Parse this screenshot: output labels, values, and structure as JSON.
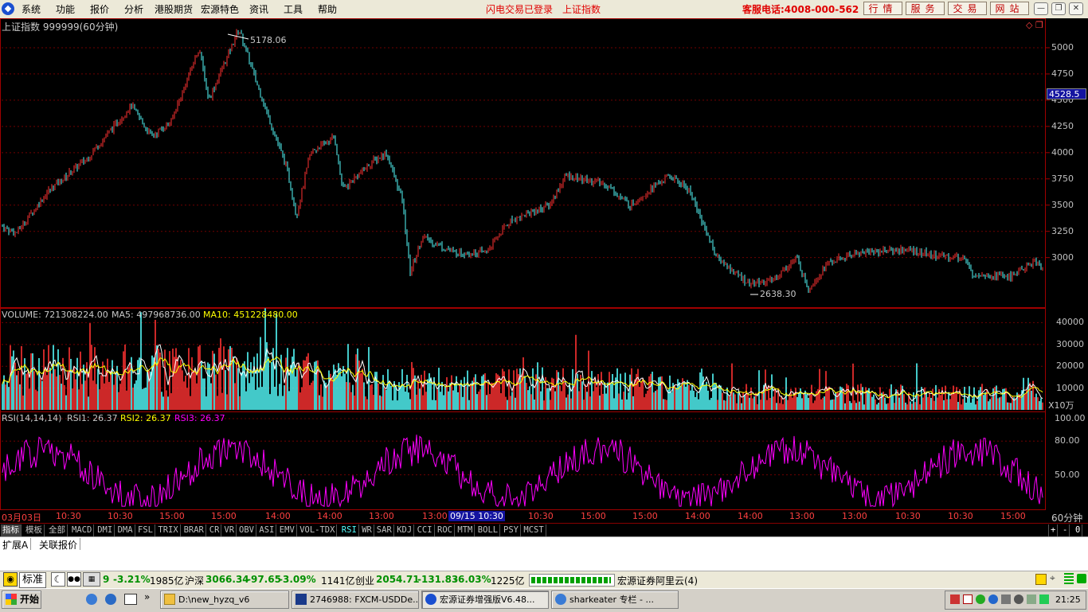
{
  "menubar": {
    "items": [
      "系统",
      "功能",
      "报价",
      "分析",
      "港股期货",
      "宏源特色",
      "资讯",
      "工具",
      "帮助"
    ],
    "status_messages": [
      "闪电交易已登录",
      "上证指数"
    ],
    "hotline": "客服电话:4008-000-562",
    "buttons": [
      "行情",
      "服务",
      "交易",
      "网站"
    ],
    "window_controls": [
      "minimize-icon",
      "restore-icon",
      "close-icon"
    ]
  },
  "main_chart": {
    "title": "上证指数 999999(60分钟)",
    "high_label": "5178.06",
    "low_label": "2638.30",
    "current_price": "4528.5",
    "y_ticks": [
      "5000",
      "4750",
      "4500",
      "4250",
      "4000",
      "3750",
      "3500",
      "3250",
      "3000"
    ]
  },
  "volume_panel": {
    "volume": "VOLUME: 721308224.00",
    "ma5": "MA5: 497968736.00",
    "ma10": "MA10: 451228480.00",
    "y_ticks": [
      "40000",
      "30000",
      "20000",
      "10000"
    ],
    "unit": "X10万"
  },
  "rsi_panel": {
    "title": "RSI(14,14,14)",
    "rsi1": "RSI1: 26.37",
    "rsi2": "RSI2: 26.37",
    "rsi3": "RSI3: 26.37",
    "y_ticks": [
      "100.00",
      "80.00",
      "50.00"
    ]
  },
  "time_axis": {
    "labels": [
      "03月03日",
      "10:30",
      "10:30",
      "15:00",
      "15:00",
      "14:00",
      "14:00",
      "13:00",
      "13:00",
      "10:30",
      "15:00",
      "15:00",
      "14:00",
      "14:00",
      "13:00",
      "13:00",
      "10:30",
      "10:30",
      "15:00"
    ],
    "cursor_label": "09/15 10:30",
    "period": "60分钟"
  },
  "indicator_tabs": [
    "指标",
    "模板",
    "全部",
    "MACD",
    "DMI",
    "DMA",
    "FSL",
    "TRIX",
    "BRAR",
    "CR",
    "VR",
    "OBV",
    "ASI",
    "EMV",
    "VOL-TDX",
    "RSI",
    "WR",
    "SAR",
    "KDJ",
    "CCI",
    "ROC",
    "MTM",
    "BOLL",
    "PSY",
    "MCST"
  ],
  "zoom_controls": [
    "+",
    "-",
    "0"
  ],
  "sub_tabs": [
    "扩展A",
    "关联报价"
  ],
  "statusbar": {
    "mode": "标准",
    "sh_pct": "-3.21%",
    "sh_amount": "1985亿",
    "hs_name": "沪深",
    "hs_value": "3066.34",
    "hs_change": "-97.65",
    "hs_pct": "-3.09%",
    "hs_amount": "1141亿",
    "cy_name": "创业",
    "cy_value": "2054.71",
    "cy_change": "-131.83",
    "cy_pct": "-6.03%",
    "cy_amount": "1225亿",
    "server": "宏源证券阿里云(4)"
  },
  "taskbar": {
    "start": "开始",
    "windows": [
      "D:\\new_hyzq_v6",
      "2746988: FXCM-USDDe...",
      "宏源证券增强版V6.48...",
      "sharkeater 专栏 - ..."
    ],
    "clock": "21:25"
  },
  "colors": {
    "up": "#ff3232",
    "down": "#54fcfc",
    "ma5": "#ffffff",
    "ma10": "#ffff00",
    "rsi": "#ff00ff",
    "axis": "#a00000"
  }
}
